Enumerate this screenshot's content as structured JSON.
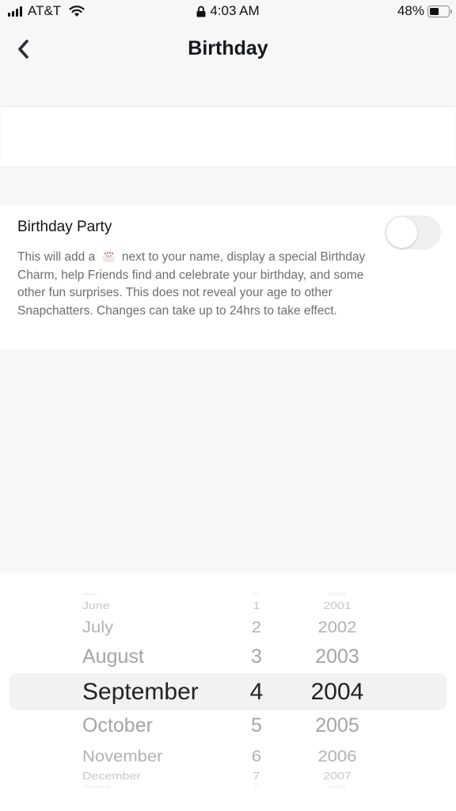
{
  "status_bar": {
    "carrier": "AT&T",
    "time": "4:03 AM",
    "battery_percent_label": "48%",
    "battery_level": 0.48,
    "icons": [
      "signal-icon",
      "wifi-icon",
      "lock-icon",
      "battery-icon"
    ]
  },
  "header": {
    "title": "Birthday",
    "back_icon": "chevron-left-icon"
  },
  "birthday_party": {
    "title": "Birthday Party",
    "description_before_icon": "This will add a",
    "description_icon": "birthday-cake-icon",
    "description_after_icon": "next to your name, display a special Birthday Charm, help Friends find and celebrate your birthday, and some other fun surprises. This does not reveal your age to other Snapchatters. Changes can take up to 24hrs to take effect.",
    "toggle_on": false
  },
  "date_picker": {
    "selected": {
      "month": "September",
      "day": "4",
      "year": "2004"
    },
    "months": [
      "May",
      "June",
      "July",
      "August",
      "September",
      "October",
      "November",
      "December",
      "January"
    ],
    "days": [
      "31",
      "1",
      "2",
      "3",
      "4",
      "5",
      "6",
      "7",
      "8"
    ],
    "years": [
      "2000",
      "2001",
      "2002",
      "2003",
      "2004",
      "2005",
      "2006",
      "2007",
      "2008"
    ]
  }
}
